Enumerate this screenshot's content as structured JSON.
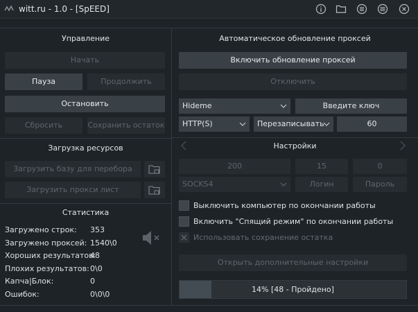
{
  "window": {
    "title": "witt.ru - 1.0 - [SpEED]",
    "icons": [
      "info-icon",
      "folder-icon",
      "list-icon",
      "menu-icon",
      "close-icon"
    ]
  },
  "control": {
    "title": "Управление",
    "start": "Начать",
    "pause": "Пауза",
    "resume": "Продолжить",
    "stop": "Остановить",
    "reset": "Сбросить",
    "save_rest": "Сохранить остаток"
  },
  "resources": {
    "title": "Загрузка ресурсов",
    "load_base": "Загрузить базу для перебора",
    "load_proxy": "Загрузить прокси лист"
  },
  "stats": {
    "title": "Статистика",
    "rows": [
      {
        "label": "Загружено строк:",
        "value": "353"
      },
      {
        "label": "Загружено проксей:",
        "value": "1540\\0"
      },
      {
        "label": "Хороших результатов:",
        "value": "48"
      },
      {
        "label": "Плохих результатов:",
        "value": "0\\0"
      },
      {
        "label": "Капча|Блок:",
        "value": "0"
      },
      {
        "label": "Ошибок:",
        "value": "0\\0\\0"
      }
    ]
  },
  "proxy": {
    "title": "Автоматическое обновление проксей",
    "enable": "Включить обновление проксей",
    "disable": "Отключить",
    "source": "Hideme",
    "key": "Введите ключ",
    "type": "HTTP(S)",
    "mode": "Перезаписывать",
    "interval": "60"
  },
  "settings": {
    "title": "Настройки",
    "threads": "200",
    "timeout": "15",
    "retries": "0",
    "proxy_type": "SOCKS4",
    "login": "Логин",
    "password": "Пароль",
    "opt_shutdown": "Выключить компьютер по окончании работы",
    "opt_sleep": "Включить \"Спящий режим\" по окончании работы",
    "opt_save_rest": "Использовать сохранение остатка",
    "advanced": "Открыть дополнительные настройки"
  },
  "progress": {
    "percent": 14,
    "text": "14% [48 - Пройдено]"
  },
  "colors": {
    "background": "#1e2327",
    "button_active": "#394147",
    "button_disabled": "#272c30",
    "progress_fill": "#434c52"
  }
}
